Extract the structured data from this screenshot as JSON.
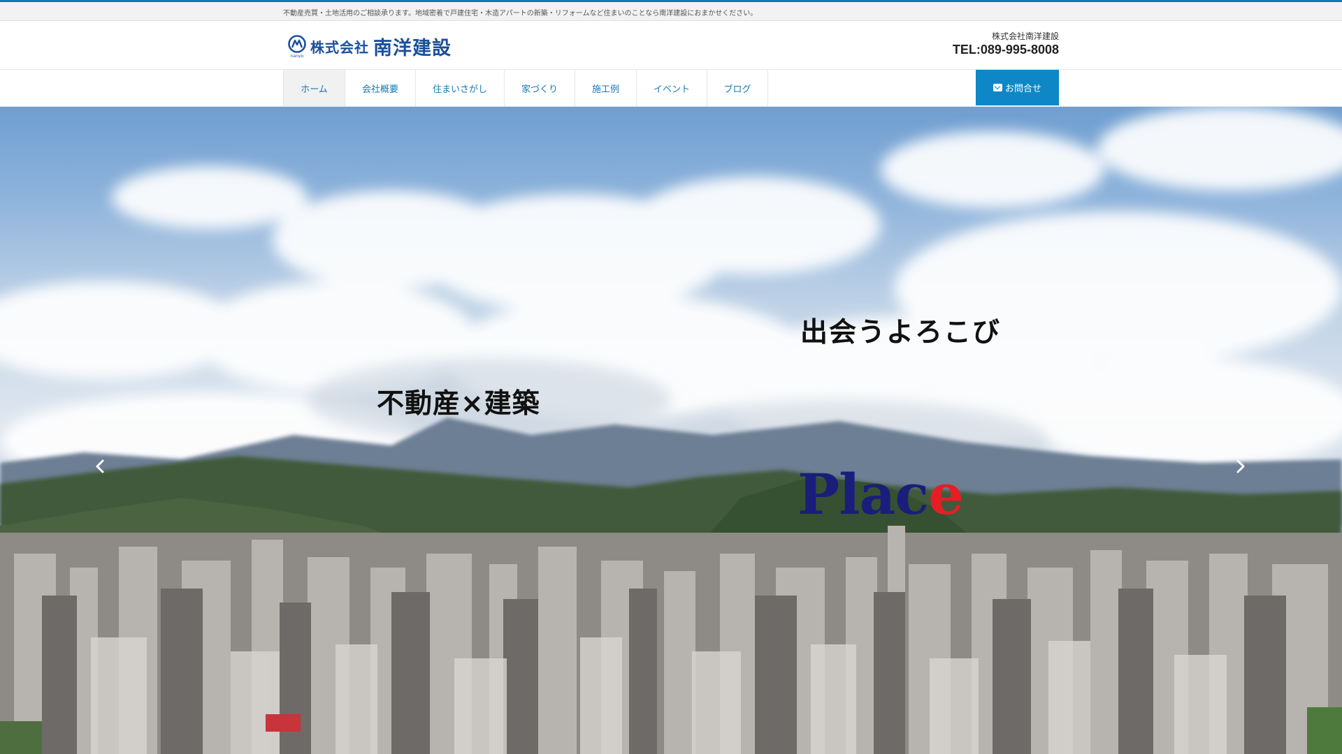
{
  "topbar": {
    "text": "不動産売買・土地活用のご相談承ります。地域密着で戸建住宅・木造アパートの新築・リフォームなど住まいのことなら南洋建設におまかせください。"
  },
  "header": {
    "logo": {
      "company_type": "株式会社",
      "company_name": "南洋建設",
      "mark_text": "nanyo"
    },
    "contact": {
      "name": "株式会社南洋建設",
      "tel": "TEL:089-995-8008"
    }
  },
  "nav": {
    "items": [
      {
        "label": "ホーム",
        "active": true
      },
      {
        "label": "会社概要",
        "active": false
      },
      {
        "label": "住まいさがし",
        "active": false
      },
      {
        "label": "家づくり",
        "active": false
      },
      {
        "label": "施工例",
        "active": false
      },
      {
        "label": "イベント",
        "active": false
      },
      {
        "label": "ブログ",
        "active": false
      }
    ],
    "contact_button": {
      "label": "お問合せ",
      "icon": "mail-icon"
    }
  },
  "hero": {
    "slogan_left": "不動産×建築",
    "slogan_right": "出会うよろこび",
    "place_main": "Plac",
    "place_accent": "e",
    "colors": {
      "place_main": "#1a1e7a",
      "place_accent": "#e31f26"
    },
    "prev_icon": "chevron-left-icon",
    "next_icon": "chevron-right-icon"
  },
  "colors": {
    "accent": "#0d87c5",
    "nav_text": "#1678b4",
    "logo": "#1b4f9c"
  }
}
